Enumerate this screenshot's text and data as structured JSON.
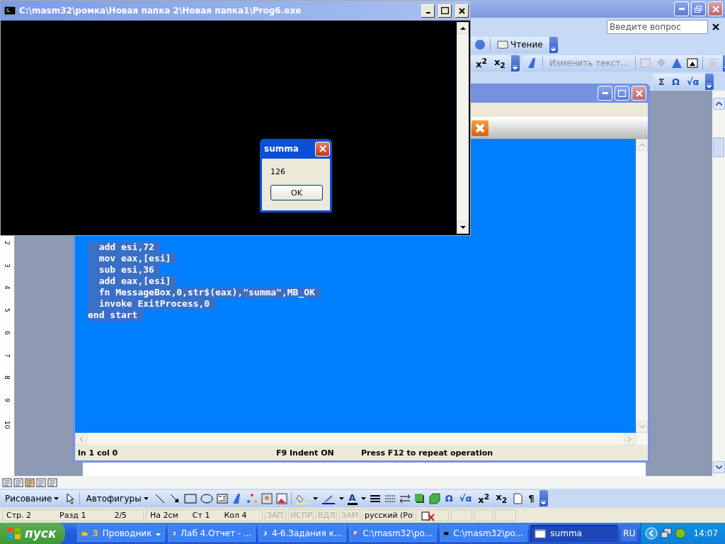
{
  "word": {
    "help_placeholder": "Введите вопрос",
    "reading_button": "Чтение",
    "format_glyphs": [
      "x$^{2}$",
      "x$_{2}$"
    ],
    "wordart_edit": "Изменить текст...",
    "insert_glyphs": [
      "Σ",
      "Ω",
      "√α"
    ],
    "ruler_marks": [
      "2",
      "3",
      "4",
      "5",
      "6",
      "7",
      "8",
      "9",
      "10"
    ],
    "drawing_toolbar": {
      "draw_menu": "Рисование",
      "autoshapes": "Автофигуры",
      "font_color": "A",
      "glyphs": [
        "Ω",
        "√α",
        "x$^{2}$",
        "x$_{2}$"
      ],
      "pilcrow": "¶"
    },
    "status_bar": {
      "position": [
        "Стр. 2",
        "Разд 1",
        "2/5"
      ],
      "cursor": [
        "На 2см",
        "Ст 1",
        "Кол 4"
      ],
      "modes": [
        {
          "label": "ЗАП",
          "disabled": true
        },
        {
          "label": "ИСПР",
          "disabled": true
        },
        {
          "label": "ВДЛ",
          "disabled": true
        },
        {
          "label": "ЗАМ",
          "disabled": true
        }
      ],
      "language": "русский (Ро"
    }
  },
  "editor": {
    "code_lines": [
      {
        "text": "  add esi,72",
        "selected": true
      },
      {
        "text": "  mov eax,[esi]",
        "selected": true
      },
      {
        "text": "  sub esi,36",
        "selected": true
      },
      {
        "text": "  add eax,[esi]",
        "selected": true
      },
      {
        "text": "  fn MessageBox,0,str$(eax),\"summa\",MB_OK",
        "selected": true
      },
      {
        "text": "  invoke ExitProcess,0",
        "selected": true
      },
      {
        "text": "end start",
        "selected": true
      }
    ],
    "status_bar": [
      "ln 1 col 0",
      "F9 Indent ON",
      "Press F12 to repeat operation"
    ]
  },
  "console": {
    "title": "C:\\masm32\\ромка\\Новая папка 2\\Новая папка1\\Prog6.exe"
  },
  "message_box": {
    "title": "summa",
    "text": "126",
    "button": "OK"
  },
  "taskbar": {
    "start": "пуск",
    "items": [
      {
        "kind": "folder",
        "count": "3",
        "label": "Проводник",
        "selected": false
      },
      {
        "kind": "word",
        "label": "Лаб 4.Отчет - ...",
        "selected": false
      },
      {
        "kind": "word",
        "label": "4-6.Задания к...",
        "selected": false
      },
      {
        "kind": "editor",
        "label": "C:\\masm32\\ро...",
        "selected": false
      },
      {
        "kind": "console",
        "label": "C:\\masm32\\ро...",
        "selected": false
      },
      {
        "kind": "window",
        "label": "summa",
        "selected": true
      }
    ],
    "language": "RU",
    "clock": "14:07"
  }
}
